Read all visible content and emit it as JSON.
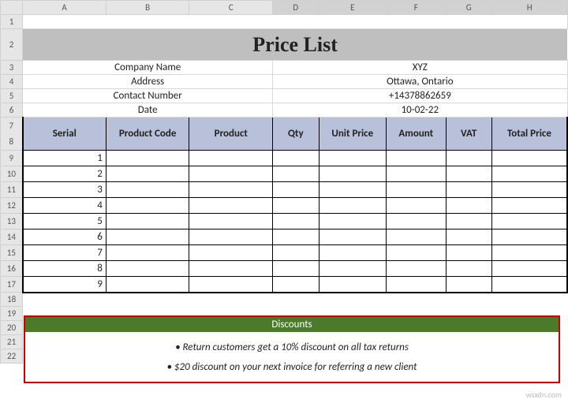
{
  "columns": [
    "A",
    "B",
    "C",
    "D",
    "E",
    "F",
    "G",
    "H"
  ],
  "rows_visible": 22,
  "title": "Price List",
  "info": {
    "company_label": "Company Name",
    "company_value": "XYZ",
    "address_label": "Address",
    "address_value": "Ottawa, Ontario",
    "contact_label": "Contact Number",
    "contact_value": "+14378862659",
    "date_label": "Date",
    "date_value": "10-02-22"
  },
  "headers": {
    "serial": "Serial",
    "product_code": "Product Code",
    "product": "Product",
    "qty": "Qty",
    "unit_price": "Unit Price",
    "amount": "Amount",
    "vat": "VAT",
    "total_price": "Total Price"
  },
  "serials": [
    "1",
    "2",
    "3",
    "4",
    "5",
    "6",
    "7",
    "8",
    "9"
  ],
  "discounts": {
    "title": "Discounts",
    "line1": "• Return customers get a 10% discount on all tax returns",
    "line2": "• $20 discount on your next invoice for referring a new client"
  },
  "watermark": "wsxdn.com"
}
